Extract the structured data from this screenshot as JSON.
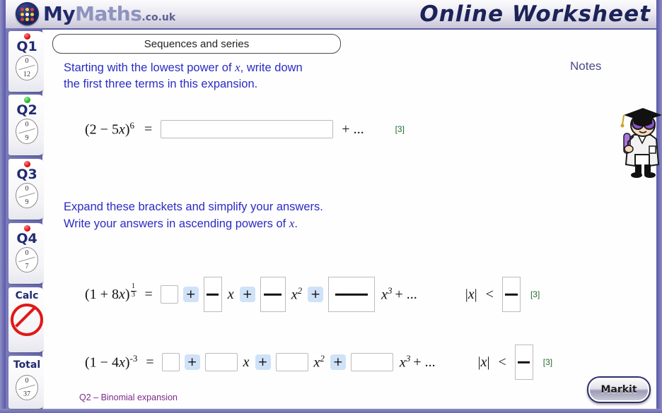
{
  "header": {
    "brand_my": "My",
    "brand_maths": "Maths",
    "brand_suffix": ".co.uk",
    "title_right": "Online Worksheet"
  },
  "sidebar": {
    "questions": [
      {
        "label": "Q1",
        "status": "red",
        "score": "0",
        "total": "12"
      },
      {
        "label": "Q2",
        "status": "green",
        "score": "0",
        "total": "9"
      },
      {
        "label": "Q3",
        "status": "red",
        "score": "0",
        "total": "9"
      },
      {
        "label": "Q4",
        "status": "red",
        "score": "0",
        "total": "7"
      }
    ],
    "calc": {
      "label": "Calc",
      "icon": "no-calculator-icon"
    },
    "total": {
      "label": "Total",
      "score": "0",
      "total": "37"
    }
  },
  "main": {
    "topic_title": "Sequences and series",
    "notes_label": "Notes",
    "footer_note": "Q2 – Binomial expansion",
    "markit_label": "Markit",
    "instruction_1_line1_a": "Starting with the lowest power of ",
    "instruction_1_line1_x": "x",
    "instruction_1_line1_b": ", write down",
    "instruction_1_line2": "the first three terms in this expansion.",
    "instruction_2_line1": "Expand these brackets and simplify your answers.",
    "instruction_2_line2_a": "Write your answers in ascending powers of ",
    "instruction_2_line2_x": "x",
    "instruction_2_line2_b": ".",
    "equals": "=",
    "plus": "+",
    "ellipsis": "+ ...",
    "plus_ellipsis": "+ ...",
    "abs_open": "|",
    "abs_close": "|",
    "less_than": "<"
  },
  "question1": {
    "expr_open": "(2 ",
    "expr_minus": "− 5",
    "expr_var": "x",
    "expr_close": ")",
    "expr_power": "6",
    "marks": "[3]",
    "answer_value": ""
  },
  "question3": {
    "expr_open": "(1 + 8",
    "expr_var": "x",
    "expr_close": ")",
    "expr_power_num": "1",
    "expr_power_den": "3",
    "marks": "[3]",
    "term_x": "x",
    "term_x2": "x",
    "term_x2_sup": "2",
    "term_x3": "x",
    "term_x3_sup": "3",
    "abs_var": "x",
    "boxes": [
      "",
      "",
      "",
      "",
      ""
    ]
  },
  "question4": {
    "expr_open": "(1 ",
    "expr_minus": "− 4",
    "expr_var": "x",
    "expr_close": ")",
    "expr_power": "-3",
    "marks": "[3]",
    "term_x": "x",
    "term_x2": "x",
    "term_x2_sup": "2",
    "term_x3": "x",
    "term_x3_sup": "3",
    "abs_var": "x",
    "boxes": [
      "",
      "",
      "",
      "",
      ""
    ]
  },
  "colors": {
    "question_text": "#2b2bc4",
    "marks": "#1f6b2b",
    "footer": "#7b2a8b",
    "frame": "#6666b0",
    "plus_button": "#cfe2f8",
    "status_red": "#d60000",
    "status_green": "#18a818"
  }
}
